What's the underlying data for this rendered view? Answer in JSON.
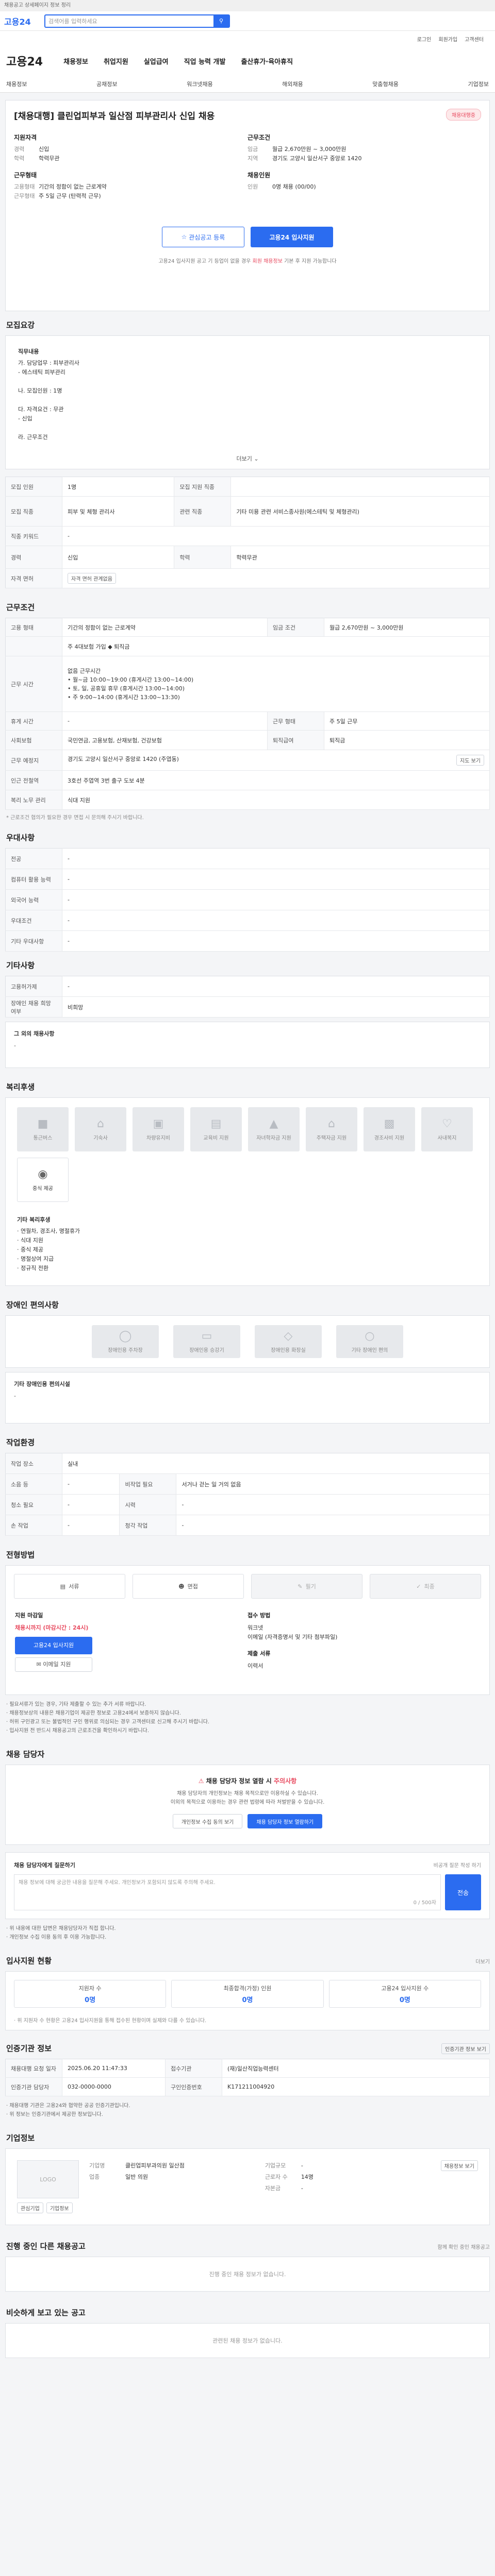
{
  "top": {
    "note": "채용공고 상세페이지 정보 정리",
    "logo": "고용24",
    "search_placeholder": "검색어를 입력하세요",
    "util": [
      "로그인",
      "회원가입",
      "고객센터"
    ]
  },
  "gnb": {
    "brand": "고용24",
    "menus": [
      "채용정보",
      "취업지원",
      "실업급여",
      "직업 능력 개발",
      "출산휴가·육아휴직"
    ],
    "sub": [
      "채용정보",
      "공채정보",
      "워크넷채용",
      "해외채용",
      "맞춤형채용",
      "기업정보"
    ]
  },
  "job": {
    "title": "[채용대행] 클린업피부과 일산점 피부관리사 신입 채용",
    "badge": "채용대행중",
    "left": {
      "group1_title": "지원자격",
      "rows1": [
        {
          "k": "경력",
          "v": "신입"
        },
        {
          "k": "학력",
          "v": "학력무관"
        }
      ],
      "group2_title": "근무형태",
      "rows2": [
        {
          "k": "고용형태",
          "v": "기간의 정함이 없는 근로계약"
        },
        {
          "k": "근무형태",
          "v": "주 5일 근무 (탄력적 근무)"
        }
      ]
    },
    "right": {
      "group1_title": "근무조건",
      "rows1": [
        {
          "k": "임금",
          "v": "월급 2,670만원 ~ 3,000만원"
        },
        {
          "k": "지역",
          "v": "경기도 고양시 일산서구 중앙로 1420"
        }
      ],
      "group2_title": "채용인원",
      "rows2": [
        {
          "k": "인원",
          "v": "0명 채용 (00/00)"
        }
      ]
    },
    "btn_scrap": "관심공고 등록",
    "btn_apply": "고용24 입사지원",
    "note_pre": "고용24 입사지원 공고 기 등업이 없을 경우 ",
    "note_red": "회원 채용정보",
    "note_post": " 기본 후 지원 가능합니다"
  },
  "detail": {
    "title": "모집요강",
    "sub1": "직무내용",
    "lines1": [
      "가. 담당업무 : 피부관리사",
      "- 에스테틱 피부관리",
      "",
      "나. 모집인원 : 1명",
      "",
      "다. 자격요건 : 무관",
      "- 신입",
      "",
      "라. 근무조건"
    ],
    "more": "더보기"
  },
  "req": {
    "rows": [
      {
        "k1": "모집 인원",
        "v1": "1명",
        "k2": "모집 지원 직종",
        "v2": ""
      },
      {
        "k1": "모집 직종",
        "v1": "피부 및 체형 관리사",
        "k2": "관련 직종",
        "v2": "기타 미용 관련 서비스종사원(에스테틱 및 체형관리)"
      },
      {
        "k1": "직종 키워드",
        "v1": "-",
        "k2": "",
        "v2": ""
      },
      {
        "k1": "경력",
        "v1": "신입",
        "k2": "학력",
        "v2": "학력무관"
      },
      {
        "k1": "자격 면허",
        "v1": "",
        "k2": "",
        "v2": ""
      }
    ],
    "license_pill": "자격 면허 관계없음"
  },
  "cond": {
    "title": "근무조건",
    "employ_k": "고용 형태",
    "employ_v": "기간의 정함이 없는 근로계약",
    "wage_k": "임금 조건",
    "wage_v": "월급 2,670만원 ~ 3,000만원",
    "bonus": "주 4대보험 가입 ◆ 퇴직금",
    "time_k": "근무 시간",
    "time_lines": [
      "없음 근무시간",
      "• 월~금 10:00~19:00 (휴게시간 13:00~14:00)",
      "• 토, 일, 공휴일 휴무 (휴게시간 13:00~14:00)",
      "• 주 9:00~14:00 (휴게시간 13:00~13:30)"
    ],
    "rows": [
      {
        "k1": "휴게 시간",
        "v1": "-",
        "k2": "근무 형태",
        "v2": "주 5일 근무"
      },
      {
        "k1": "사회보험",
        "v1": "국민연금, 고용보험, 산재보험, 건강보험",
        "k2": "퇴직급여",
        "v2": "퇴직금"
      }
    ],
    "loc_k": "근무 예정지",
    "loc_v": "경기도 고양시 일산서구 중앙로 1420 (주엽동)",
    "map_btn": "지도 보기",
    "nearby_k": "인근 전철역",
    "nearby_v": "3호선 주엽역 3번 출구 도보 4분",
    "etc_k": "복리 노무 관리",
    "etc_v": "식대 지원",
    "footnote": "* 근로조건 협의가 필요한 경우 면접 시 문의해 주시기 바랍니다."
  },
  "prefer": {
    "title": "우대사항",
    "rows": [
      {
        "k": "전공",
        "v": "-"
      },
      {
        "k": "컴퓨터 활용 능력",
        "v": "-"
      },
      {
        "k": "외국어 능력",
        "v": "-"
      },
      {
        "k": "우대조건",
        "v": "-"
      },
      {
        "k": "기타 우대사항",
        "v": "-"
      }
    ]
  },
  "etc": {
    "title": "기타사항",
    "rows": [
      {
        "k": "고용허가제",
        "v": "-"
      },
      {
        "k": "장애인 채용 희망 여부",
        "v": "비희망"
      }
    ],
    "box_title": "그 외의 채용사항",
    "box_text": "-"
  },
  "welfare": {
    "title": "복리후생",
    "tiles": [
      "통근버스",
      "기숙사",
      "차량유지비",
      "교육비 지원",
      "자녀학자금 지원",
      "주택자금 지원",
      "경조사비 지원",
      "사내복지",
      "중식 제공"
    ],
    "list": [
      "· 연월차, 경조사, 명절휴가",
      "· 식대 지원",
      "· 중식 제공",
      "· 명절상여 지급",
      "· 정규직 전환"
    ]
  },
  "disabled": {
    "title": "장애인 편의사항",
    "tiles": [
      "장애인용 주차장",
      "장애인용 승강기",
      "장애인용 화장실",
      "기타 장애인 편의"
    ],
    "box_title": "기타 장애인용 편의시설",
    "box_text": "-"
  },
  "env": {
    "title": "작업환경",
    "rows": [
      {
        "k1": "작업 장소",
        "v1": "실내",
        "k2": "",
        "v2": ""
      },
      {
        "k1": "소음 등",
        "v1": "-",
        "k2": "비작업 필요",
        "v2": "서거나 걷는 일 거의 없음"
      },
      {
        "k1": "청소 필요",
        "v1": "-",
        "k2": "시력",
        "v2": "-"
      },
      {
        "k1": "손 작업",
        "v1": "-",
        "k2": "청각 작업",
        "v2": "-"
      }
    ]
  },
  "apply": {
    "title": "전형방법",
    "steps": [
      "서류",
      "면접",
      "필기",
      "최종"
    ],
    "col1_t": "지원 마감일",
    "col1_dl": "채용시까지 (마감시간 : 24시)",
    "col1_btn": "고용24 입사지원",
    "col1_btn2": "이메일 지원",
    "col2_t": "접수 방법",
    "col2_lines": [
      "워크넷",
      "이메일 (자격증명서 및 기타 첨부파일)"
    ],
    "col2_t2": "제출 서류",
    "col2_v2": "이력서",
    "bullets": [
      "· 필요서류가 있는 경우, 기타 제출할 수 있는 추가 서류 바랍니다.",
      "· 채용정보상의 내용은 채용기업이 제공한 정보로 고용24에서 보증하지 않습니다.",
      "· 허위 구인광고 또는 불법적인 구인 행위로 의심되는 경우 고객센터로 신고해 주시기 바랍니다.",
      "· 입사지원 전 반드시 채용공고의 근로조건을 확인하시기 바랍니다."
    ]
  },
  "contact": {
    "title": "채용 담당자",
    "warn_pre": "채용 담당자 정보 열람 시 ",
    "warn_ex": "주의사항",
    "p1": "채용 담당자의 개인정보는 채용 목적으로만 이용하실 수 있습니다.",
    "p2": "이외의 목적으로 이용하는 경우 관련 법령에 따라 처벌받을 수 있습니다.",
    "btn1": "개인정보 수집 동의 보기",
    "btn2": "채용 담당자 정보 열람하기"
  },
  "qa": {
    "title": "채용 담당자에게 질문하기",
    "right": "비공개 질문 작성 하기",
    "placeholder": "채용 정보에 대해 궁금한 내용을 질문해 주세요. 개인정보가 포함되지 않도록 주의해 주세요.",
    "count": "0 / 500자",
    "send": "전송",
    "notes": [
      "· 위 내용에 대한 답변은 채용담당자가 직접 합니다.",
      "· 개인정보 수집 이용 동의 후 이용 가능합니다."
    ]
  },
  "stats": {
    "title": "입사지원 현황",
    "more": "더보기",
    "items": [
      {
        "label": "지원자 수",
        "n": "0명"
      },
      {
        "label": "최종합격(가정) 인원",
        "n": "0명"
      },
      {
        "label": "고용24 입사지원 수",
        "n": "0명"
      }
    ],
    "note": "· 위 지원자 수 현황은 고용24 입사지원을 통해 접수된 현황이며 실제와 다를 수 있습니다."
  },
  "info": {
    "title": "인증기관 정보",
    "more": "인증기관 정보 보기",
    "rows": [
      {
        "k1": "채용대행 요청 일자",
        "v1": "2025.06.20 11:47:33",
        "k2": "접수기관",
        "v2": "(재)일산직업능력센터"
      },
      {
        "k1": "인증기관 담당자",
        "v1": "032-0000-0000",
        "k2": "구인인증번호",
        "v2": "K171211004920"
      }
    ],
    "notes": [
      "· 채용대행 기관은 고용24와 협약한 공공 인증기관입니다.",
      "· 위 정보는 인증기관에서 제공한 정보입니다."
    ]
  },
  "company": {
    "title": "기업정보",
    "logo": "LOGO",
    "btn_a": "관심기업",
    "btn_b": "기업정보",
    "name_k": "기업명",
    "name_v": "클린업피부과의원 일산점",
    "sector_k": "업종",
    "sector_v": "일반 의원",
    "size_k": "기업규모",
    "size_v": "-",
    "emp_k": "근로자 수",
    "emp_v": "14명",
    "cap_k": "자본금",
    "cap_v": "-",
    "btn_more": "채용정보 보기"
  },
  "more_jobs": {
    "title": "진행 중인 다른 채용공고",
    "right": "함께 확인 중인 채용공고",
    "empty": "진행 중인 채용 정보가 없습니다."
  },
  "similar": {
    "title": "비슷하게 보고 있는 공고",
    "empty": "관련된 채용 정보가 없습니다."
  }
}
